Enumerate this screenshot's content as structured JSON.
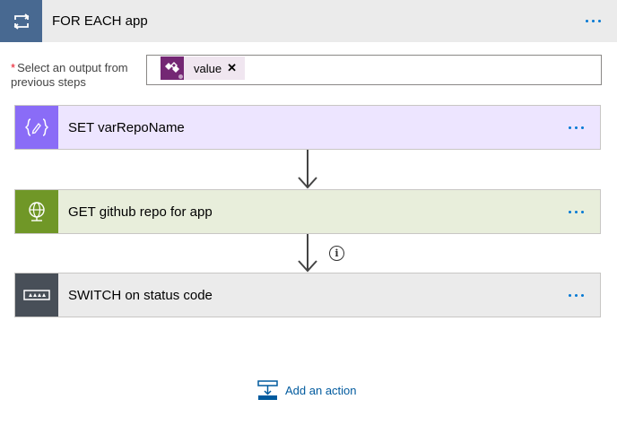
{
  "loop": {
    "title": "FOR EACH app",
    "icon": "loop-icon",
    "color": "#486991"
  },
  "select": {
    "required_marker": "*",
    "label": "Select an output from previous steps",
    "token": {
      "label": "value",
      "icon": "dataverse-icon",
      "color": "#742774",
      "close": "✕"
    }
  },
  "actions": [
    {
      "title": "SET varRepoName",
      "icon": "variable-icon",
      "color": "#8a6cf7",
      "bg": "#ede5ff"
    },
    {
      "title": "GET github repo for app",
      "icon": "globe-icon",
      "color": "#709727",
      "bg": "#e8eedb"
    },
    {
      "title": "SWITCH on status code",
      "icon": "switch-icon",
      "color": "#484f58",
      "bg": "#ebebeb"
    }
  ],
  "info_glyph": "i",
  "add_action": {
    "label": "Add an action",
    "icon": "add-action-icon"
  }
}
